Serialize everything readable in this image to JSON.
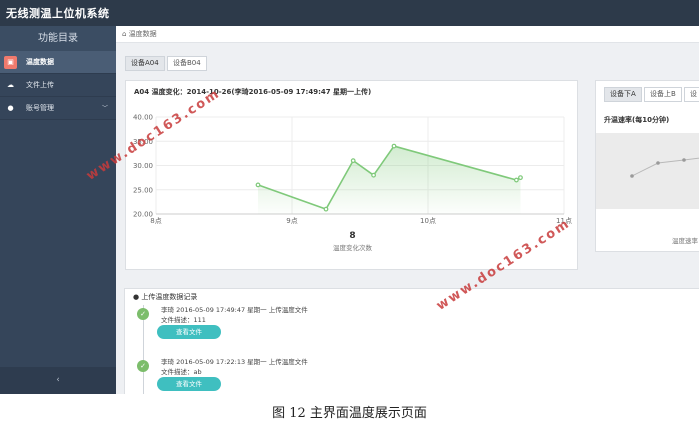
{
  "app": {
    "title": "无线测温上位机系统"
  },
  "sidebar": {
    "heading": "功能目录",
    "items": [
      {
        "label": "温度数据",
        "icon": "image-icon"
      },
      {
        "label": "文件上传",
        "icon": "cloud-icon"
      },
      {
        "label": "账号管理",
        "icon": "user-icon"
      }
    ],
    "collapse_glyph": "‹"
  },
  "breadcrumb": {
    "text": "温度数据"
  },
  "device_tabs": [
    "设备A04",
    "设备B04"
  ],
  "main_chart": {
    "title": "A04 温度变化：2014-10-26(李琦2016-05-09 17:49:47 星期一上传)",
    "count_value": "8",
    "count_label": "温度变化次数"
  },
  "chart_data": {
    "type": "area",
    "xlabel": "",
    "ylabel": "",
    "xticks": [
      "8点",
      "9点",
      "10点",
      "11点"
    ],
    "yticks": [
      "20.00",
      "25.00",
      "30.00",
      "35.00",
      "40.00"
    ],
    "ylim": [
      20,
      40
    ],
    "xlim": [
      8,
      11
    ],
    "x": [
      8.75,
      9.25,
      9.45,
      9.6,
      9.75,
      10.65,
      10.68
    ],
    "values": [
      26,
      21,
      31,
      28,
      34,
      27,
      27.5
    ],
    "color": "#7fc97a"
  },
  "side_panel": {
    "tabs": [
      "设备下A",
      "设备上B",
      "设"
    ],
    "title": "升温速率(每10分钟)",
    "footer": "温度速率"
  },
  "upload_log": {
    "title": "上传温度数据记录",
    "entries": [
      {
        "line1": "李琦 2016-05-09 17:49:47 星期一 上传温度文件",
        "line2": "文件描述：111",
        "button": "查看文件"
      },
      {
        "line1": "李琦 2016-05-09 17:22:13 星期一 上传温度文件",
        "line2": "文件描述：ab",
        "button": "查看文件"
      }
    ]
  },
  "watermark": {
    "text": "www.doc163.com"
  },
  "caption": {
    "text": "图 12  主界面温度展示页面"
  }
}
